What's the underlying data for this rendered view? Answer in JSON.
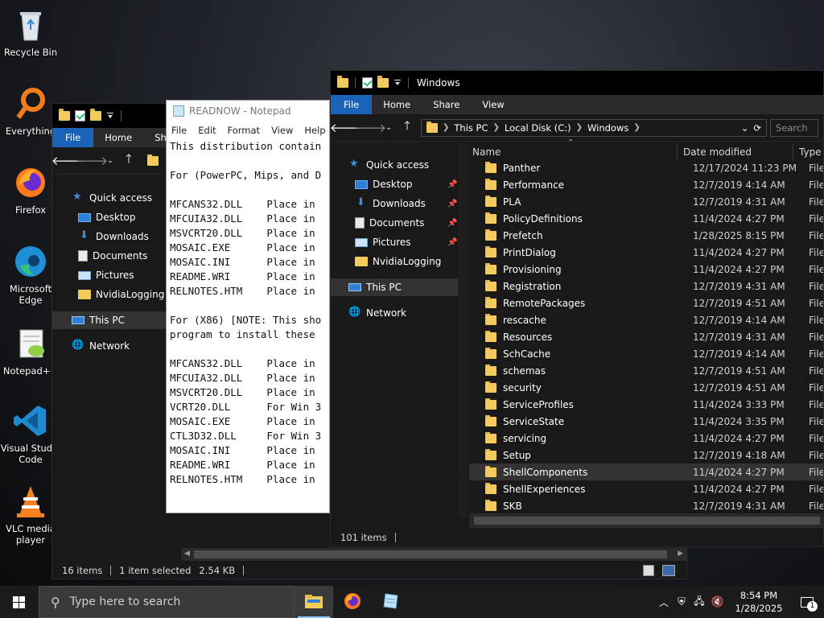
{
  "desktop": {
    "icons": [
      {
        "label": "Recycle Bin",
        "icon": "recycle-bin-icon"
      },
      {
        "label": "Everything",
        "icon": "everything-search-icon"
      },
      {
        "label": "Firefox",
        "icon": "firefox-icon"
      },
      {
        "label": "Microsoft Edge",
        "icon": "edge-icon"
      },
      {
        "label": "Notepad++",
        "icon": "notepad-plus-plus-icon"
      },
      {
        "label": "Visual Studio Code",
        "icon": "vscode-icon"
      },
      {
        "label": "VLC media player",
        "icon": "vlc-icon"
      }
    ]
  },
  "left_explorer": {
    "ribbon": {
      "file": "File",
      "home": "Home",
      "share": "Sh"
    },
    "nav": {
      "quick_access": "Quick access",
      "desktop": "Desktop",
      "downloads": "Downloads",
      "documents": "Documents",
      "pictures": "Pictures",
      "nvidia": "NvidiaLogging",
      "this_pc": "This PC",
      "network": "Network"
    },
    "status": {
      "items": "16 items",
      "selected": "1 item selected",
      "size": "2.54 KB"
    }
  },
  "notepad": {
    "title": "READNOW - Notepad",
    "menu": {
      "file": "File",
      "edit": "Edit",
      "format": "Format",
      "view": "View",
      "help": "Help"
    },
    "lines": [
      "This distribution contain",
      "",
      "For (PowerPC, Mips, and D",
      "",
      "MFCANS32.DLL    Place in ",
      "MFCUIA32.DLL    Place in ",
      "MSVCRT20.DLL    Place in ",
      "MOSAIC.EXE      Place in ",
      "MOSAIC.INI      Place in ",
      "README.WRI      Place in ",
      "RELNOTES.HTM    Place in ",
      "",
      "For (X86) [NOTE: This sho",
      "program to install these ",
      "",
      "MFCANS32.DLL    Place in ",
      "MFCUIA32.DLL    Place in ",
      "MSVCRT20.DLL    Place in ",
      "VCRT20.DLL      For Win 3",
      "MOSAIC.EXE      Place in ",
      "CTL3D32.DLL     For Win 3",
      "MOSAIC.INI      Place in ",
      "README.WRI      Place in ",
      "RELNOTES.HTM    Place in "
    ]
  },
  "right_explorer": {
    "title": "Windows",
    "ribbon": {
      "file": "File",
      "home": "Home",
      "share": "Share",
      "view": "View"
    },
    "address": [
      "This PC",
      "Local Disk (C:)",
      "Windows"
    ],
    "search_placeholder": "Search",
    "nav": {
      "quick_access": "Quick access",
      "desktop": "Desktop",
      "downloads": "Downloads",
      "documents": "Documents",
      "pictures": "Pictures",
      "nvidia": "NvidiaLogging",
      "this_pc": "This PC",
      "network": "Network"
    },
    "columns": {
      "name": "Name",
      "date": "Date modified",
      "type": "Type"
    },
    "rows": [
      {
        "name": "Panther",
        "date": "12/17/2024 11:23 PM",
        "type": "File folder"
      },
      {
        "name": "Performance",
        "date": "12/7/2019 4:14 AM",
        "type": "File folder"
      },
      {
        "name": "PLA",
        "date": "12/7/2019 4:31 AM",
        "type": "File folder"
      },
      {
        "name": "PolicyDefinitions",
        "date": "11/4/2024 4:27 PM",
        "type": "File folder"
      },
      {
        "name": "Prefetch",
        "date": "1/28/2025 8:15 PM",
        "type": "File folder"
      },
      {
        "name": "PrintDialog",
        "date": "11/4/2024 4:27 PM",
        "type": "File folder"
      },
      {
        "name": "Provisioning",
        "date": "11/4/2024 4:27 PM",
        "type": "File folder"
      },
      {
        "name": "Registration",
        "date": "12/7/2019 4:31 AM",
        "type": "File folder"
      },
      {
        "name": "RemotePackages",
        "date": "12/7/2019 4:51 AM",
        "type": "File folder"
      },
      {
        "name": "rescache",
        "date": "12/7/2019 4:14 AM",
        "type": "File folder"
      },
      {
        "name": "Resources",
        "date": "12/7/2019 4:31 AM",
        "type": "File folder"
      },
      {
        "name": "SchCache",
        "date": "12/7/2019 4:14 AM",
        "type": "File folder"
      },
      {
        "name": "schemas",
        "date": "12/7/2019 4:51 AM",
        "type": "File folder"
      },
      {
        "name": "security",
        "date": "12/7/2019 4:51 AM",
        "type": "File folder"
      },
      {
        "name": "ServiceProfiles",
        "date": "11/4/2024 3:33 PM",
        "type": "File folder"
      },
      {
        "name": "ServiceState",
        "date": "11/4/2024 3:35 PM",
        "type": "File folder"
      },
      {
        "name": "servicing",
        "date": "11/4/2024 4:27 PM",
        "type": "File folder"
      },
      {
        "name": "Setup",
        "date": "12/7/2019 4:18 AM",
        "type": "File folder"
      },
      {
        "name": "ShellComponents",
        "date": "11/4/2024 4:27 PM",
        "type": "File folder"
      },
      {
        "name": "ShellExperiences",
        "date": "11/4/2024 4:27 PM",
        "type": "File folder"
      },
      {
        "name": "SKB",
        "date": "12/7/2019 4:31 AM",
        "type": "File folder"
      }
    ],
    "selected_row": "ShellComponents",
    "status": {
      "items": "101 items"
    }
  },
  "taskbar": {
    "search_placeholder": "Type here to search",
    "apps": [
      "file-explorer-icon",
      "firefox-icon",
      "notepad-icon"
    ],
    "time": "8:54 PM",
    "date": "1/28/2025",
    "notification_count": "1"
  },
  "colors": {
    "accent": "#1a63b8",
    "folder": "#f2cb5c",
    "selection": "#333333"
  }
}
